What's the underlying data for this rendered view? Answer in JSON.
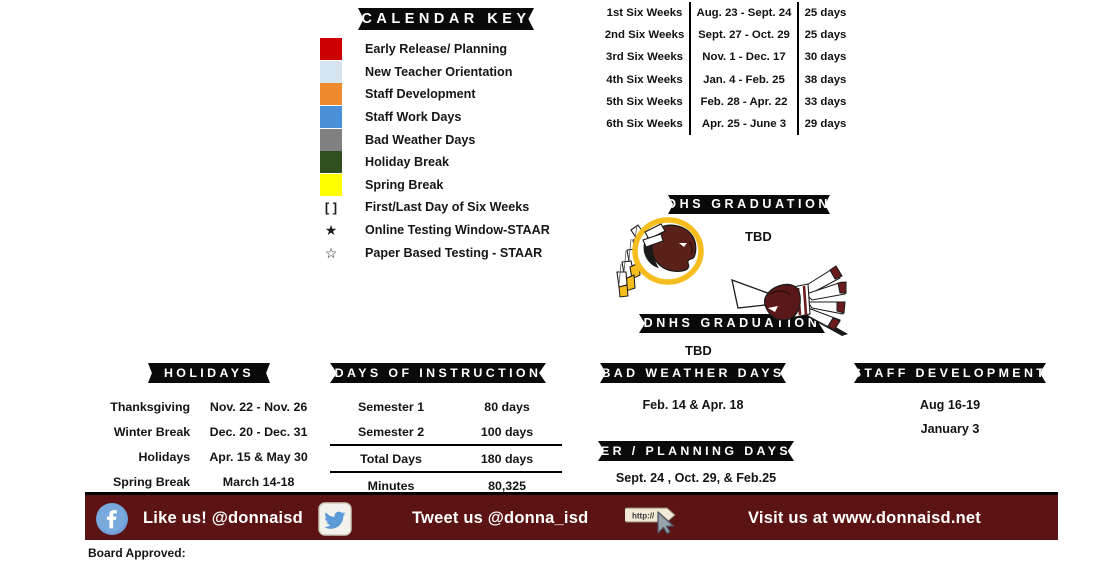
{
  "calendar_key": {
    "banner": "CALENDAR KEY",
    "items": [
      {
        "label": "Early Release/ Planning",
        "type": "swatch",
        "color": "#CC0000"
      },
      {
        "label": "New Teacher Orientation",
        "type": "swatch",
        "color": "#D6E4F0"
      },
      {
        "label": "Staff Development",
        "type": "swatch",
        "color": "#F08A2E"
      },
      {
        "label": "Staff Work Days",
        "type": "swatch",
        "color": "#4A90D9"
      },
      {
        "label": "Bad Weather Days",
        "type": "swatch",
        "color": "#808080"
      },
      {
        "label": "Holiday Break",
        "type": "swatch",
        "color": "#2F4F1E"
      },
      {
        "label": "Spring Break",
        "type": "swatch",
        "color": "#FFFF00"
      },
      {
        "label": "First/Last Day of Six Weeks",
        "type": "symbol",
        "symbol": "[ ]"
      },
      {
        "label": "Online Testing Window-STAAR",
        "type": "symbol",
        "symbol": "★"
      },
      {
        "label": "Paper Based Testing - STAAR",
        "type": "symbol",
        "symbol": "☆"
      }
    ]
  },
  "six_weeks": {
    "rows": [
      {
        "term": "1st Six Weeks",
        "dates": "Aug. 23 - Sept. 24",
        "days": "25 days"
      },
      {
        "term": "2nd Six Weeks",
        "dates": "Sept. 27 - Oct. 29",
        "days": "25 days"
      },
      {
        "term": "3rd Six Weeks",
        "dates": "Nov. 1 - Dec. 17",
        "days": "30 days"
      },
      {
        "term": "4th Six Weeks",
        "dates": "Jan. 4 - Feb. 25",
        "days": "38 days"
      },
      {
        "term": "5th Six Weeks",
        "dates": "Feb. 28 - Apr. 22",
        "days": "33 days"
      },
      {
        "term": "6th Six Weeks",
        "dates": "Apr. 25 - June 3",
        "days": "29 days"
      }
    ]
  },
  "graduation": {
    "dhs_banner": "DHS GRADUATION",
    "dhs_value": "TBD",
    "dnhs_banner": "DNHS GRADUATION",
    "dnhs_value": "TBD",
    "dhs_logo_name": "redskins-mascot-logo",
    "dnhs_logo_name": "chief-headdress-mascot-logo"
  },
  "holidays": {
    "banner": "HOLIDAYS",
    "rows": [
      {
        "label": "Thanksgiving",
        "value": "Nov. 22 - Nov. 26"
      },
      {
        "label": "Winter Break",
        "value": "Dec. 20 - Dec.  31"
      },
      {
        "label": "Holidays",
        "value": "Apr. 15 & May 30"
      },
      {
        "label": "Spring Break",
        "value": "March 14-18"
      }
    ]
  },
  "instruction": {
    "banner": "DAYS OF INSTRUCTION",
    "rows": [
      {
        "label": "Semester 1",
        "value": "80 days"
      },
      {
        "label": "Semester 2",
        "value": "100 days"
      },
      {
        "label": "Total Days",
        "value": "180 days"
      },
      {
        "label": "Minutes",
        "value": "80,325"
      }
    ]
  },
  "bad_weather": {
    "banner": "BAD WEATHER DAYS",
    "value": "Feb. 14 & Apr. 18"
  },
  "er_planning": {
    "banner": "ER / PLANNING DAYS",
    "value": "Sept. 24 , Oct. 29, & Feb.25"
  },
  "staff_development": {
    "banner": "STAFF DEVELOPMENT",
    "values": [
      "Aug 16-19",
      "January 3"
    ]
  },
  "footer": {
    "background_color": "#5C1313",
    "facebook_icon": "facebook-icon",
    "like_text": "Like us! @donnaisd",
    "twitter_icon": "twitter-icon",
    "tweet_text": "Tweet us @donna_isd",
    "http_icon": "http-link-cursor-icon",
    "visit_text": "Visit us at www.donnaisd.net"
  },
  "board_approved": "Board Approved:"
}
